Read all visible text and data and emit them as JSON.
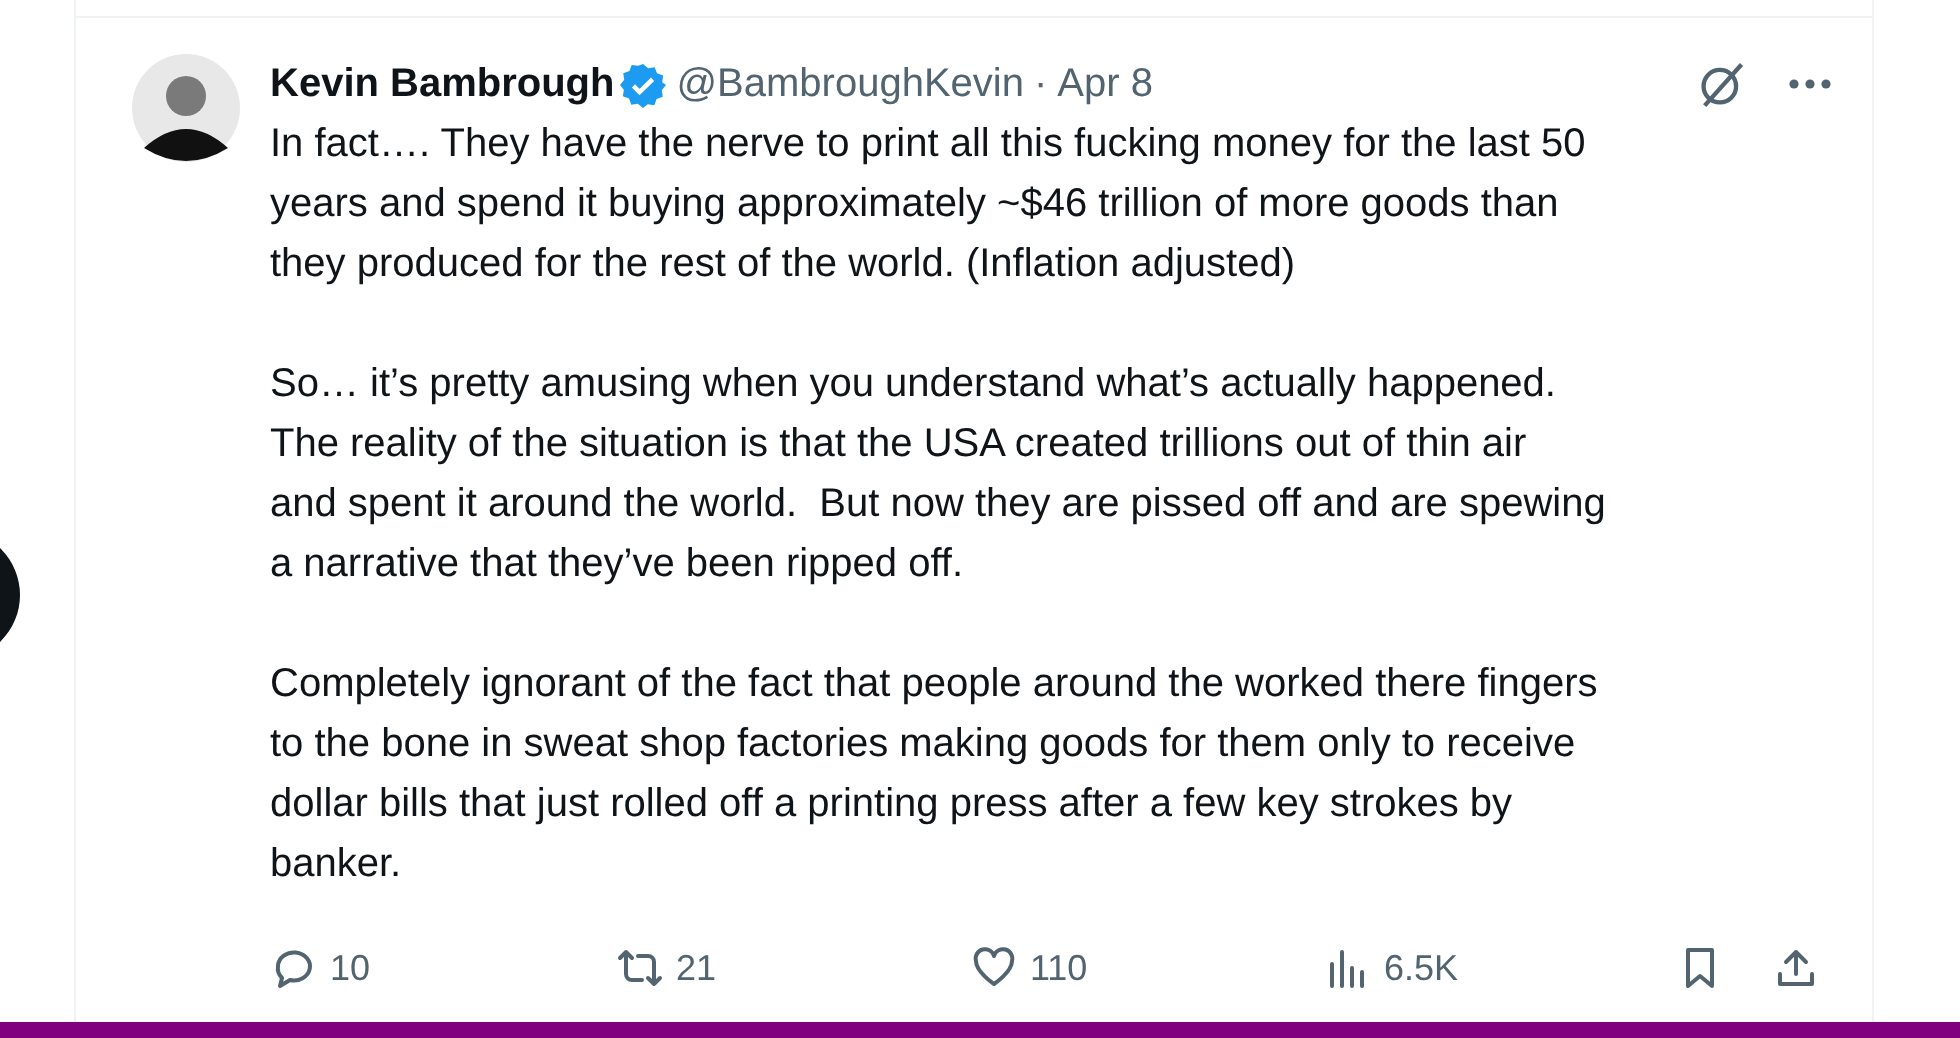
{
  "tweet": {
    "author": {
      "name": "Kevin Bambrough",
      "verified": true,
      "handle": "@BambroughKevin",
      "separator": "·",
      "date": "Apr 8"
    },
    "paragraphs": [
      [
        "In fact…. They have the nerve to print all this fucking money for the last 50",
        "years and spend it buying approximately ~$46 trillion of more goods than",
        "they produced for the rest of the world. (Inflation adjusted)"
      ],
      [
        "So… it’s pretty amusing when you understand what’s actually happened.",
        "The reality of the situation is that the USA created trillions out of thin air",
        "and spent it around the world.  But now they are pissed off and are spewing",
        "a narrative that they’ve been ripped off."
      ],
      [
        "Completely ignorant of the fact that people around the worked there fingers",
        "to the bone in sweat shop factories making goods for them only to receive",
        "dollar bills that just rolled off a printing press after a few key strokes by",
        "banker."
      ]
    ],
    "actions": [
      {
        "kind": "reply",
        "count": "10"
      },
      {
        "kind": "retweet",
        "count": "21"
      },
      {
        "kind": "like",
        "count": "110"
      },
      {
        "kind": "views",
        "count": "6.5K"
      }
    ]
  }
}
